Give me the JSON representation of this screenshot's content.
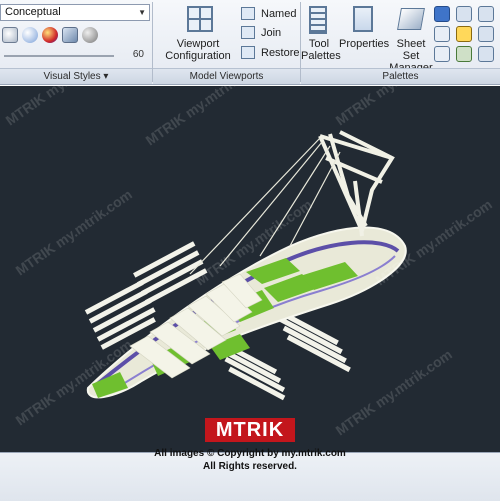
{
  "ribbon": {
    "visual_styles": {
      "style_value": "Conceptual",
      "slider_value": "60",
      "title": "Visual Styles"
    },
    "model_viewports": {
      "viewport_config_label_1": "Viewport",
      "viewport_config_label_2": "Configuration",
      "named_label": "Named",
      "join_label": "Join",
      "restore_label": "Restore",
      "title": "Model Viewports"
    },
    "palettes": {
      "tool_palettes_label_1": "Tool",
      "tool_palettes_label_2": "Palettes",
      "properties_label": "Properties",
      "sheet_set_label_1": "Sheet Set",
      "sheet_set_label_2": "Manager",
      "title": "Palettes"
    }
  },
  "watermark": {
    "logo": "MTRIK",
    "copyright": "All images © Copyright by my.mtrik.com",
    "rights": "All Rights reserved.",
    "tile_text": "MTRIK my.mtrik.com"
  },
  "colors": {
    "viewport_bg": "#222a33",
    "green_surface": "#6fbf2f",
    "purple_edge": "#5c4fa8",
    "bridge_white": "#f1f1e6"
  },
  "icons": [
    "shade-icon",
    "sphere-icon",
    "material-icon",
    "shadow-icon",
    "viewport-config-icon",
    "named-icon",
    "join-icon",
    "restore-icon",
    "tool-palettes-icon",
    "properties-icon",
    "sheet-set-icon"
  ]
}
